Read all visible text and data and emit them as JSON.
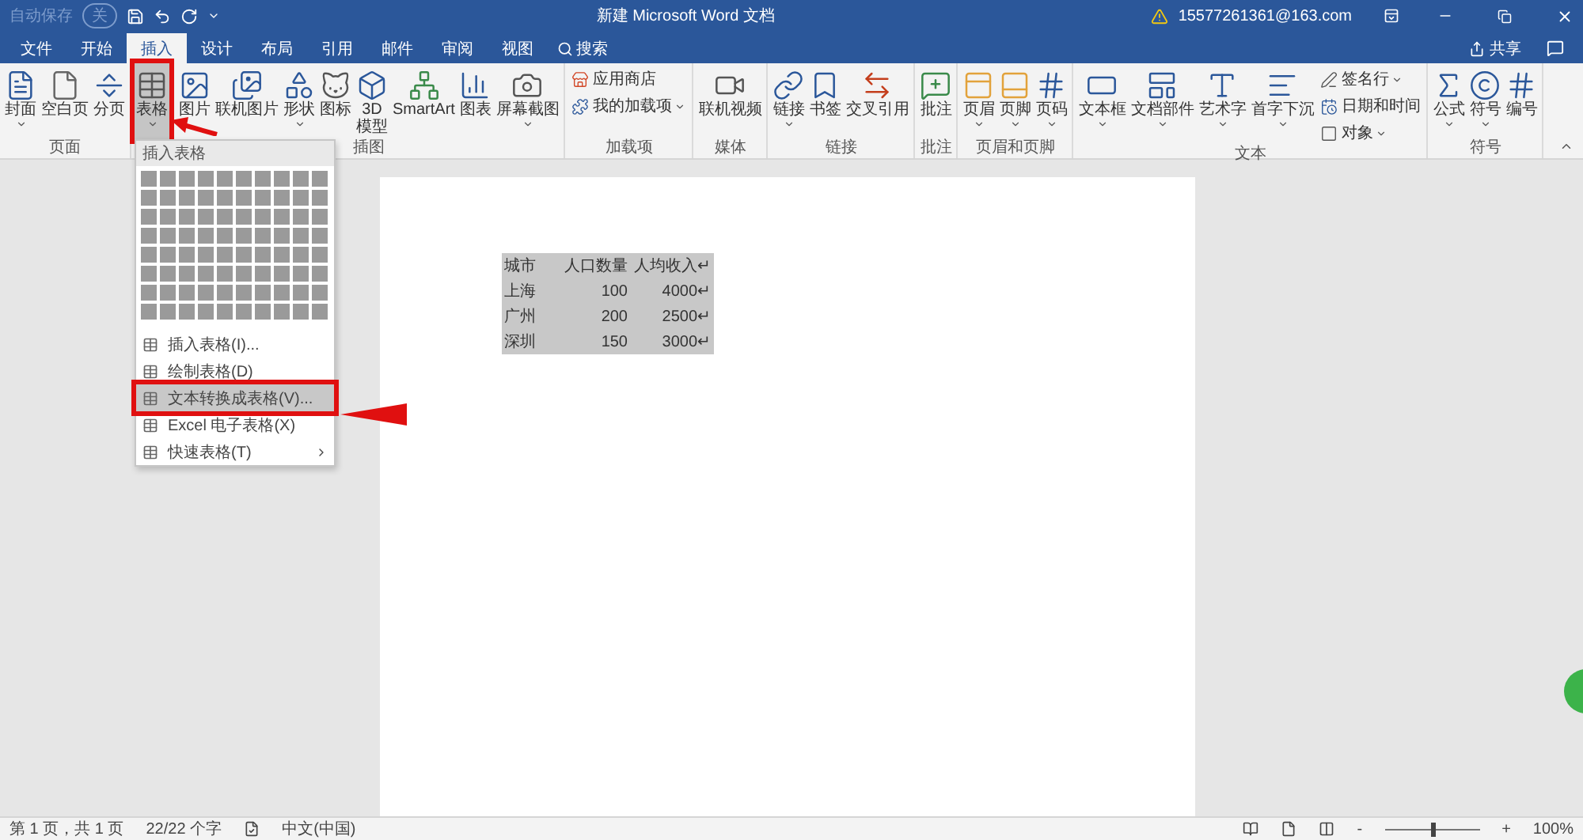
{
  "title_bar": {
    "autosave": {
      "label": "自动保存",
      "toggle": "关",
      "on": false
    },
    "title": "新建 Microsoft Word 文档",
    "account": "15577261361@163.com"
  },
  "tabs": [
    {
      "label": "文件",
      "selected": false
    },
    {
      "label": "开始",
      "selected": false
    },
    {
      "label": "插入",
      "selected": true
    },
    {
      "label": "设计",
      "selected": false
    },
    {
      "label": "布局",
      "selected": false
    },
    {
      "label": "引用",
      "selected": false
    },
    {
      "label": "邮件",
      "selected": false
    },
    {
      "label": "审阅",
      "selected": false
    },
    {
      "label": "视图",
      "selected": false
    }
  ],
  "search": {
    "placeholder": "搜索"
  },
  "share": "共享",
  "ribbon_groups": [
    {
      "label": "页面",
      "items": [
        {
          "label": "封面",
          "kind": "large",
          "dropdown": true,
          "pressed": false
        },
        {
          "label": "空白页",
          "kind": "large",
          "dropdown": false,
          "pressed": false
        },
        {
          "label": "分页",
          "kind": "large",
          "dropdown": false,
          "pressed": false
        }
      ]
    },
    {
      "items": [
        {
          "label": "表格",
          "kind": "large",
          "dropdown": true,
          "pressed": true
        }
      ]
    },
    {
      "label": "插图",
      "items": [
        {
          "label": "图片",
          "kind": "large",
          "dropdown": false,
          "pressed": false
        },
        {
          "label": "联机图片",
          "kind": "large",
          "dropdown": false,
          "pressed": false
        },
        {
          "label": "形状",
          "kind": "large",
          "dropdown": true,
          "pressed": false
        },
        {
          "label": "图标",
          "kind": "large",
          "dropdown": false,
          "pressed": false
        },
        {
          "label": "3D\n模型",
          "kind": "large",
          "dropdown": false,
          "pressed": false
        },
        {
          "label": "SmartArt",
          "kind": "large",
          "dropdown": false,
          "pressed": false
        },
        {
          "label": "图表",
          "kind": "large",
          "dropdown": false,
          "pressed": false
        },
        {
          "label": "屏幕截图",
          "kind": "large",
          "dropdown": true,
          "pressed": false
        }
      ]
    },
    {
      "label": "加载项",
      "items": [
        {
          "label": "应用商店",
          "kind": "small",
          "dropdown": false,
          "pressed": false
        },
        {
          "label": "我的加载项",
          "kind": "small",
          "dropdown": true,
          "pressed": false
        }
      ]
    },
    {
      "label": "媒体",
      "items": [
        {
          "label": "联机视频",
          "kind": "large",
          "dropdown": false,
          "pressed": false
        }
      ]
    },
    {
      "label": "链接",
      "items": [
        {
          "label": "链接",
          "kind": "large",
          "dropdown": true,
          "pressed": false
        },
        {
          "label": "书签",
          "kind": "large",
          "dropdown": false,
          "pressed": false
        },
        {
          "label": "交叉引用",
          "kind": "large",
          "dropdown": false,
          "pressed": false
        }
      ]
    },
    {
      "label": "批注",
      "items": [
        {
          "label": "批注",
          "kind": "large",
          "dropdown": false,
          "pressed": false
        }
      ]
    },
    {
      "label": "页眉和页脚",
      "items": [
        {
          "label": "页眉",
          "kind": "large",
          "dropdown": true,
          "pressed": false
        },
        {
          "label": "页脚",
          "kind": "large",
          "dropdown": true,
          "pressed": false
        },
        {
          "label": "页码",
          "kind": "large",
          "dropdown": true,
          "pressed": false
        }
      ]
    },
    {
      "label": "文本",
      "items": [
        {
          "label": "文本框",
          "kind": "large",
          "dropdown": true,
          "pressed": false
        },
        {
          "label": "文档部件",
          "kind": "large",
          "dropdown": true,
          "pressed": false
        },
        {
          "label": "艺术字",
          "kind": "large",
          "dropdown": true,
          "pressed": false
        },
        {
          "label": "首字下沉",
          "kind": "large",
          "dropdown": true,
          "pressed": false
        },
        {
          "label": "签名行",
          "kind": "small",
          "dropdown": true,
          "pressed": false
        },
        {
          "label": "日期和时间",
          "kind": "small",
          "dropdown": false,
          "pressed": false
        },
        {
          "label": "对象",
          "kind": "small",
          "dropdown": true,
          "pressed": false
        }
      ]
    },
    {
      "label": "符号",
      "items": [
        {
          "label": "公式",
          "kind": "large",
          "dropdown": true,
          "pressed": false
        },
        {
          "label": "符号",
          "kind": "large",
          "dropdown": true,
          "pressed": false
        },
        {
          "label": "编号",
          "kind": "large",
          "dropdown": false,
          "pressed": false
        }
      ]
    }
  ],
  "table_menu": {
    "header": "插入表格",
    "items": [
      {
        "label": "插入表格(I)...",
        "selected": false,
        "submenu": false
      },
      {
        "label": "绘制表格(D)",
        "selected": false,
        "submenu": false
      },
      {
        "label": "文本转换成表格(V)...",
        "selected": true,
        "submenu": false
      },
      {
        "label": "Excel 电子表格(X)",
        "selected": false,
        "submenu": false
      },
      {
        "label": "快速表格(T)",
        "selected": false,
        "submenu": true
      }
    ]
  },
  "document_table": {
    "selected": true,
    "rows": [
      [
        "城市",
        "人口数量",
        "人均收入↵"
      ],
      [
        "上海",
        "100",
        "4000↵"
      ],
      [
        "广州",
        "200",
        "2500↵"
      ],
      [
        "深圳",
        "150",
        "3000↵"
      ]
    ]
  },
  "status_bar": {
    "page": "第 1 页，共 1 页",
    "words": "22/22 个字",
    "language": "中文(中国)",
    "zoom": {
      "minus": "-",
      "plus": "+",
      "level": 0.5,
      "reading": "100%"
    }
  }
}
